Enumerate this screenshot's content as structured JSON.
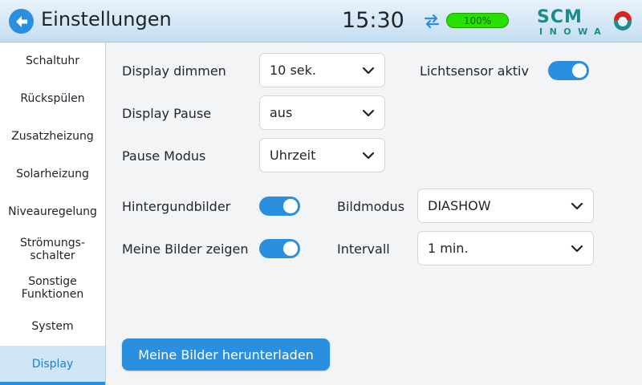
{
  "header": {
    "title": "Einstellungen",
    "time": "15:30",
    "battery": "100%",
    "logo": {
      "top": "SCM",
      "bottom": "INOWA"
    }
  },
  "sidebar": {
    "items": [
      {
        "label": "Schaltuhr"
      },
      {
        "label": "Rückspülen"
      },
      {
        "label": "Zusatzheizung"
      },
      {
        "label": "Solarheizung"
      },
      {
        "label": "Niveauregelung"
      },
      {
        "label": "Strömungs-\nschalter"
      },
      {
        "label": "Sonstige\nFunktionen"
      },
      {
        "label": "System"
      },
      {
        "label": "Display"
      }
    ],
    "active": "Display"
  },
  "settings": {
    "display_dimmen": {
      "label": "Display dimmen",
      "value": "10 sek."
    },
    "display_pause": {
      "label": "Display Pause",
      "value": "aus"
    },
    "pause_modus": {
      "label": "Pause Modus",
      "value": "Uhrzeit"
    },
    "lichtsensor": {
      "label": "Lichtsensor aktiv",
      "on": true
    },
    "hintergrundbilder": {
      "label": "Hintergundbilder",
      "on": true
    },
    "meine_bilder": {
      "label": "Meine Bilder zeigen",
      "on": true
    },
    "bildmodus": {
      "label": "Bildmodus",
      "value": "DIASHOW"
    },
    "intervall": {
      "label": "Intervall",
      "value": "1 min."
    }
  },
  "download_button": "Meine Bilder herunterladen",
  "colors": {
    "accent": "#2b8fe0",
    "battery": "#26e000",
    "logo_teal": "#1a8c8c",
    "logo_red": "#e0201c"
  }
}
